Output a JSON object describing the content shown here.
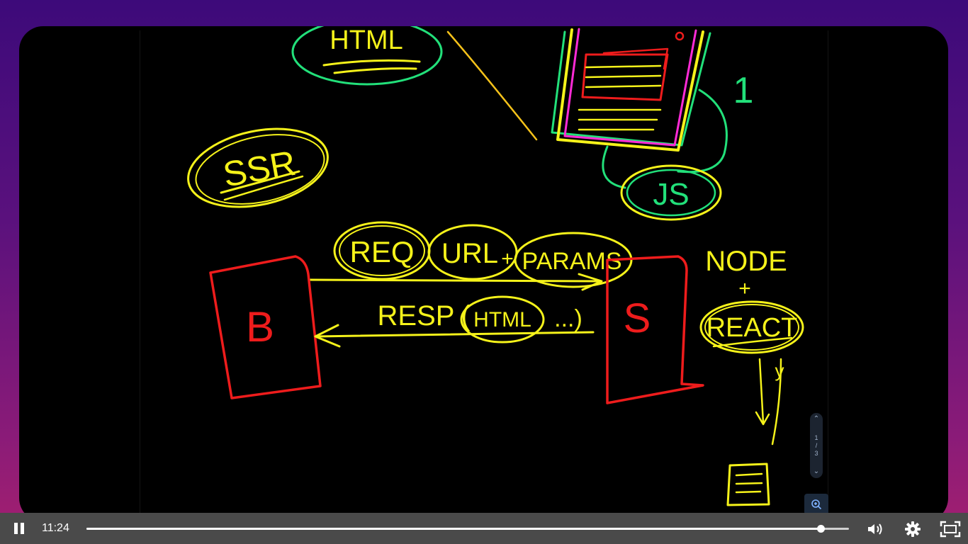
{
  "player": {
    "current_time": "11:24",
    "progress_fraction": 0.963
  },
  "whiteboard": {
    "labels": {
      "html_top": "HTML",
      "ssr": "SSR",
      "one": "1",
      "js": "JS",
      "req": "REQ",
      "url": "URL",
      "plus1": "+",
      "params": "PARAMS",
      "b": "B",
      "s": "S",
      "resp": "RESP",
      "html_resp": "HTML",
      "dots": "...)",
      "paren_open": "(",
      "node": "NODE",
      "plus2": "+",
      "react": "REACT",
      "y": "y"
    },
    "colors": {
      "yellow": "#f5f21a",
      "green": "#22e07a",
      "red": "#ee1c1c",
      "magenta": "#ff2bd6"
    }
  },
  "page_nav": {
    "current": "1",
    "separator": "/",
    "total": "3"
  },
  "icons": {
    "pause": "pause-icon",
    "volume": "volume-icon",
    "settings": "gear-icon",
    "fullscreen": "fullscreen-icon",
    "zoom": "zoom-in-icon",
    "chev_up": "chevron-up-icon",
    "chev_down": "chevron-down-icon"
  }
}
